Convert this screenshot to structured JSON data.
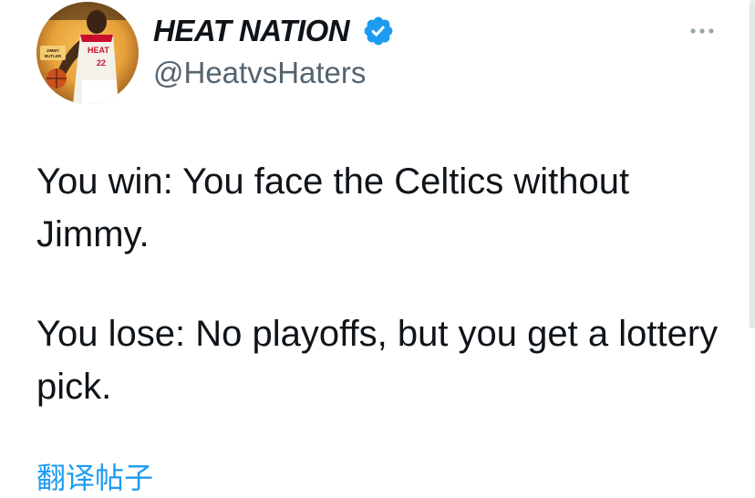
{
  "author": {
    "display_name": "HEAT NATION",
    "handle": "@HeatvsHaters",
    "verified": true,
    "avatar_badge_text": "JIMMY BUTLER",
    "avatar_jersey_text": "HEAT",
    "avatar_jersey_number": "22"
  },
  "tweet": {
    "paragraphs": [
      "You win: You face the Celtics without Jimmy.",
      "You lose: No playoffs, but you get a lottery pick."
    ],
    "translate_label": "翻译帖子"
  },
  "colors": {
    "text_primary": "#0f1419",
    "text_secondary": "#536471",
    "link_blue": "#1d9bf0",
    "verified_blue": "#1d9bf0",
    "avatar_gold": "#e8a13a"
  },
  "icons": {
    "verified": "verified-badge-icon",
    "more": "more-horizontal-icon"
  }
}
